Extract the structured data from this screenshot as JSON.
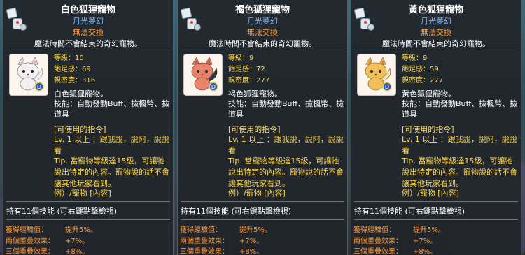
{
  "tooltips": [
    {
      "title": "白色狐狸寵物",
      "subtitle": "月光夢幻",
      "tradeable": "無法交換",
      "description": "魔法時間不會結束的奇幻寵物。",
      "stats": {
        "level_label": "等級：",
        "level": "10",
        "fullness_label": "飽足感：",
        "fullness": "69",
        "intimacy_label": "親密度：",
        "intimacy": "316"
      },
      "pet_name": "白色狐狸寵物。",
      "skills": "技能：自動發動Buff、撿楓幣、撿道具",
      "commands_title": "[可使用的指令]",
      "cmd_1": "Lv. 1 以上 ：跟我說，說阿，說說看",
      "cmd_tip": "Tip. 當寵物等級達15級，可讓牠說出特定的內容。寵物說的話不會讓其他玩家看到。",
      "cmd_example": "例）/寵物 [內容]",
      "skill_count": "持有11個技能 (可右鍵點擊檢視)",
      "bonuses": [
        {
          "label": "獲得經驗值：",
          "value": "提升5%。"
        },
        {
          "label": "兩個重疊效果：",
          "value": "+7%。"
        },
        {
          "label": "三個重疊效果：",
          "value": "+8%。"
        }
      ],
      "fox_color": "#f4f0f2",
      "ear_color": "#e8b0c0"
    },
    {
      "title": "褐色狐狸寵物",
      "subtitle": "月光夢幻",
      "tradeable": "無法交換",
      "description": "魔法時間不會結束的奇幻寵物。",
      "stats": {
        "level_label": "等級：",
        "level": "9",
        "fullness_label": "飽足感：",
        "fullness": "72",
        "intimacy_label": "親密度：",
        "intimacy": "277"
      },
      "pet_name": "褐色狐狸寵物。",
      "skills": "技能：自動發動Buff、撿楓幣、撿道具",
      "commands_title": "[可使用的指令]",
      "cmd_1": "Lv. 1 以上 ：跟我說，說阿，說說看",
      "cmd_tip": "Tip. 當寵物等級達15級，可讓牠說出特定的內容。寵物說的話不會讓其他玩家看到。",
      "cmd_example": "例）/寵物 [內容]",
      "skill_count": "持有11個技能 (可右鍵點擊檢視)",
      "bonuses": [
        {
          "label": "獲得經驗值：",
          "value": "提升5%。"
        },
        {
          "label": "兩個重疊效果：",
          "value": "+7%。"
        },
        {
          "label": "三個重疊效果：",
          "value": "+8%。"
        }
      ],
      "fox_color": "#e9836a",
      "ear_color": "#c45a48"
    },
    {
      "title": "黃色狐狸寵物",
      "subtitle": "月光夢幻",
      "tradeable": "無法交換",
      "description": "魔法時間不會結束的奇幻寵物。",
      "stats": {
        "level_label": "等級：",
        "level": "9",
        "fullness_label": "飽足感：",
        "fullness": "59",
        "intimacy_label": "親密度：",
        "intimacy": "277"
      },
      "pet_name": "黃色狐狸寵物。",
      "skills": "技能：自動發動Buff、撿楓幣、撿道具",
      "commands_title": "[可使用的指令]",
      "cmd_1": "Lv. 1 以上 ：跟我說，說阿，說說看",
      "cmd_tip": "Tip. 當寵物等級達15級，可讓牠說出特定的內容。寵物說的話不會讓其他玩家看到。",
      "cmd_example": "例）/寵物 [內容]",
      "skill_count": "持有11個技能 (可右鍵點擊檢視)",
      "bonuses": [
        {
          "label": "獲得經驗值：",
          "value": "提升5%。"
        },
        {
          "label": "兩個重疊效果：",
          "value": "+7%。"
        },
        {
          "label": "三個重疊效果：",
          "value": "+8%。"
        }
      ],
      "fox_color": "#f2c05a",
      "ear_color": "#d98a30"
    }
  ]
}
